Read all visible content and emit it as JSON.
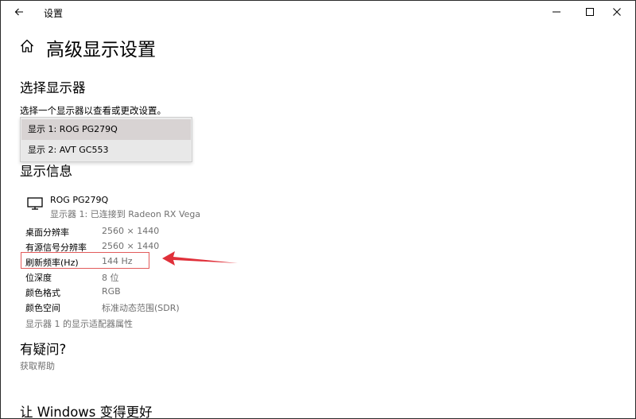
{
  "window": {
    "title": "设置",
    "back_icon": "back-arrow-icon",
    "controls": [
      "minimize-icon",
      "maximize-icon",
      "close-icon"
    ]
  },
  "page": {
    "title": "高级显示设置",
    "home_icon": "home-icon"
  },
  "select_display": {
    "heading": "选择显示器",
    "hint": "选择一个显示器以查看或更改设置。",
    "options": [
      {
        "label": "显示 1: ROG PG279Q",
        "selected": true
      },
      {
        "label": "显示 2: AVT GC553",
        "selected": false
      }
    ]
  },
  "display_info": {
    "heading": "显示信息",
    "monitor_name": "ROG PG279Q",
    "monitor_connection": "显示器 1: 已连接到 Radeon RX Vega",
    "rows": [
      {
        "label": "桌面分辨率",
        "value": "2560 × 1440"
      },
      {
        "label": "有源信号分辨率",
        "value": "2560 × 1440"
      },
      {
        "label": "刷新频率(Hz)",
        "value": "144 Hz"
      },
      {
        "label": "位深度",
        "value": "8 位"
      },
      {
        "label": "颜色格式",
        "value": "RGB"
      },
      {
        "label": "颜色空间",
        "value": "标准动态范围(SDR)"
      }
    ],
    "adapter_link": "显示器 1 的显示适配器属性"
  },
  "help": {
    "heading": "有疑问?",
    "link": "获取帮助"
  },
  "feedback": {
    "heading": "让 Windows 变得更好"
  },
  "colors": {
    "highlight": "#e25b5b",
    "arrow": "#e0303a",
    "secondary_text": "#6f6f6f"
  }
}
